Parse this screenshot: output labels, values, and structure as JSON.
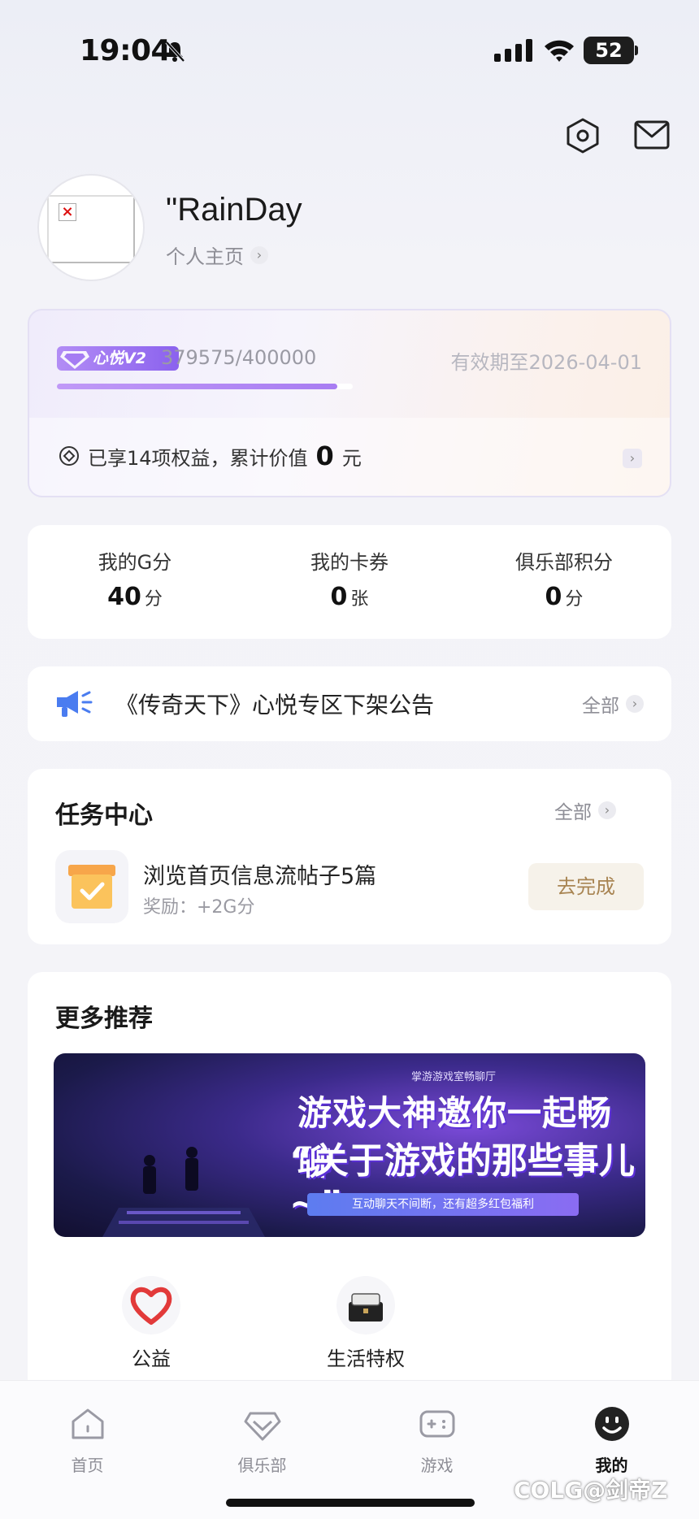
{
  "status_bar": {
    "time": "19:04",
    "battery": "52"
  },
  "profile": {
    "username": "\"RainDay",
    "homepage_label": "个人主页"
  },
  "vip": {
    "badge": "心悦V2",
    "points": "379575/400000",
    "progress": 0.949,
    "expiry": "有效期至2026-04-01",
    "rights_prefix": "已享14项权益，累计价值",
    "rights_value": "0",
    "rights_unit": "元"
  },
  "stats": [
    {
      "label": "我的G分",
      "value": "40",
      "unit": "分"
    },
    {
      "label": "我的卡券",
      "value": "0",
      "unit": "张"
    },
    {
      "label": "俱乐部积分",
      "value": "0",
      "unit": "分"
    }
  ],
  "notice": {
    "text": "《传奇天下》心悦专区下架公告",
    "all_label": "全部"
  },
  "task_center": {
    "title": "任务中心",
    "all_label": "全部",
    "task_name": "浏览首页信息流帖子5篇",
    "task_reward": "奖励：+2G分",
    "button_label": "去完成"
  },
  "recommend": {
    "title": "更多推荐",
    "banner": {
      "sub": "掌游游戏室畅聊厅",
      "line1": "游戏大神邀你一起畅聊",
      "line2": "“关于游戏的那些事儿~”",
      "pill": "互动聊天不间断，还有超多红包福利"
    },
    "shortcuts": [
      {
        "label": "公益",
        "icon": "heart-icon"
      },
      {
        "label": "生活特权",
        "icon": "gift-box-icon"
      }
    ]
  },
  "tabbar": [
    {
      "label": "首页",
      "icon": "home-icon"
    },
    {
      "label": "俱乐部",
      "icon": "diamond-icon"
    },
    {
      "label": "游戏",
      "icon": "gamepad-icon"
    },
    {
      "label": "我的",
      "icon": "smiley-icon",
      "active": true
    }
  ],
  "watermark": "COLG@剑帝Z"
}
